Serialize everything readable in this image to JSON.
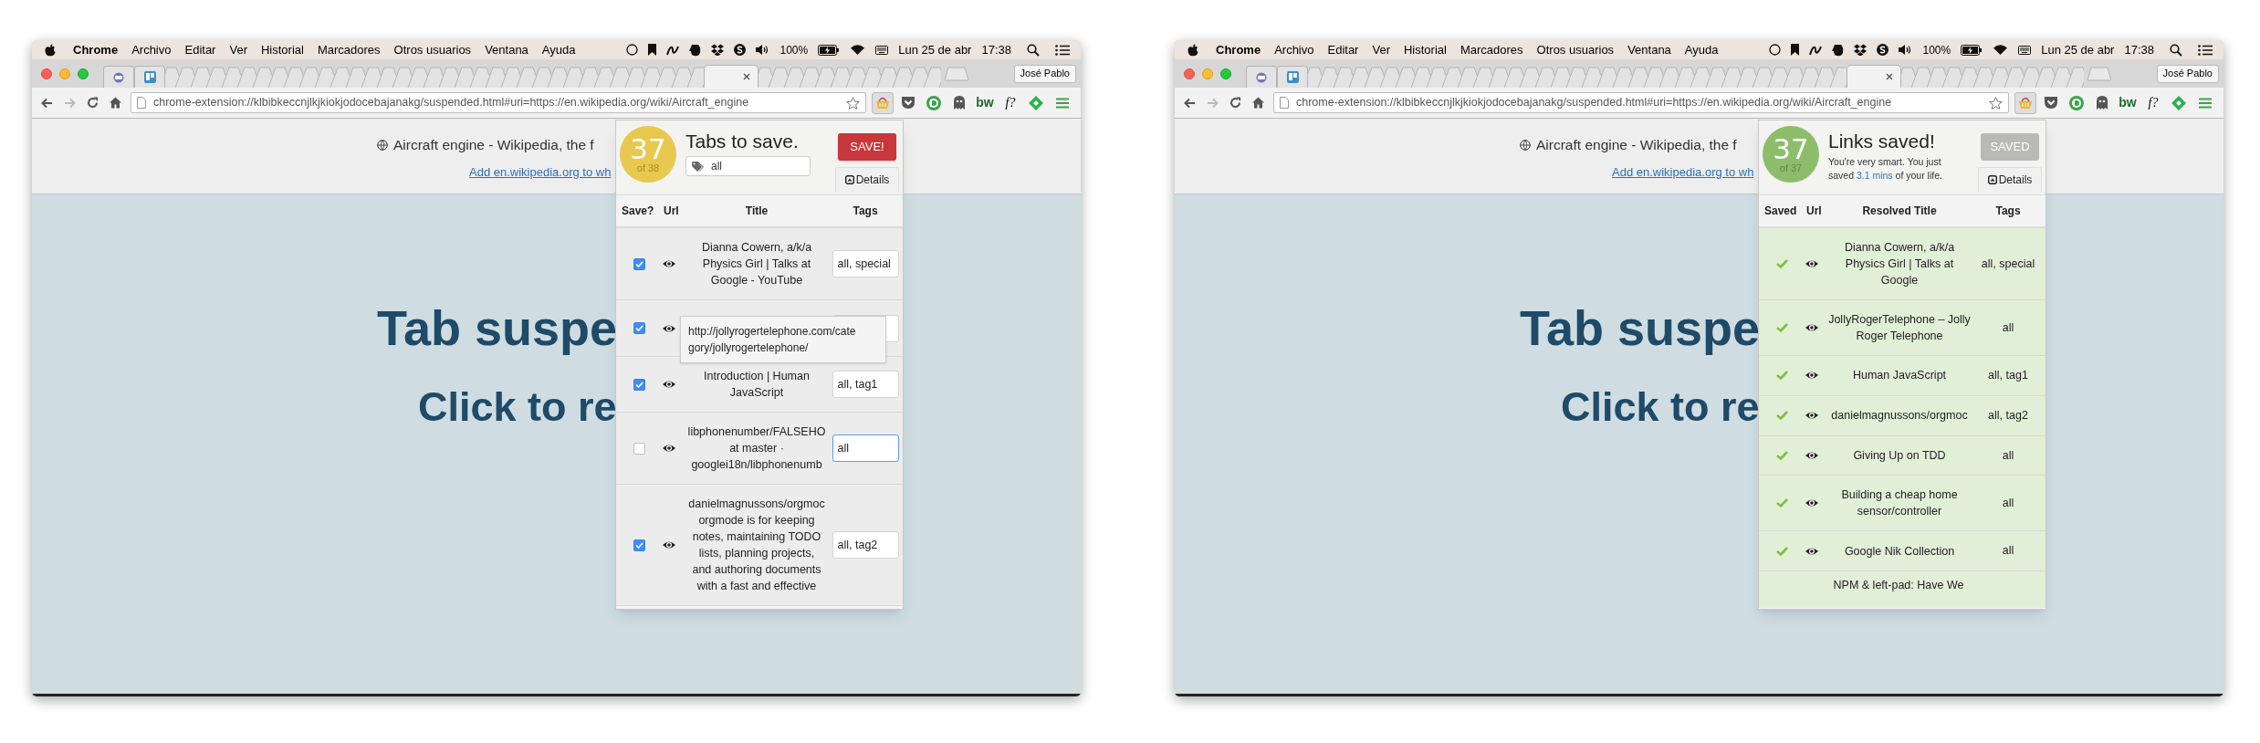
{
  "windows": [
    {
      "menu_bar": {
        "app": "Chrome",
        "items": [
          "Archivo",
          "Editar",
          "Ver",
          "Historial",
          "Marcadores",
          "Otros usuarios",
          "Ventana",
          "Ayuda"
        ],
        "battery": "100%",
        "date": "Lun 25 de abr",
        "time": "17:38"
      },
      "profile": "José Pablo",
      "url": "chrome-extension://klbibkeccnjlkjkiokjodocebajanakg/suspended.html#uri=https://en.wikipedia.org/wiki/Aircraft_engine",
      "extensions": [
        {
          "kind": "basket",
          "active": true
        },
        {
          "kind": "pocket",
          "active": false
        },
        {
          "kind": "ring",
          "active": false
        },
        {
          "kind": "ghost",
          "active": false
        },
        {
          "kind": "text",
          "label": "bw",
          "active": false
        },
        {
          "kind": "text",
          "label": "f?",
          "active": false
        },
        {
          "kind": "diamond",
          "active": false
        }
      ],
      "page": {
        "title": "Aircraft engine - Wikipedia, the f",
        "link": "Add en.wikipedia.org to wh",
        "heading": "Tab suspe",
        "subheading": "Click to re"
      },
      "popup": {
        "kind": "pending",
        "count": "37",
        "total": "of 38",
        "title": "Tabs to save.",
        "tag_filter": "all",
        "button": {
          "label": "SAVE!",
          "disabled": false
        },
        "details": "Details",
        "columns": [
          "Save?",
          "Url",
          "Title",
          "Tags"
        ],
        "rows": [
          {
            "checked": true,
            "focused": false,
            "title_lines": [
              "Dianna Cowern, a/k/a",
              "Physics Girl | Talks at",
              "Google - YouTube"
            ],
            "tags": "all, special"
          },
          {
            "checked": true,
            "focused": false
          },
          {
            "checked": true,
            "focused": false,
            "title_lines": [
              "Introduction | Human",
              "JavaScript"
            ],
            "tags": "all, tag1"
          },
          {
            "checked": false,
            "focused": true,
            "title_lines": [
              "libphonenumber/FALSEHO",
              "at master ·",
              "googlei18n/libphonenumb"
            ],
            "tags": "all"
          },
          {
            "checked": true,
            "focused": false,
            "title_lines": [
              "danielmagnussons/orgmoc",
              "orgmode is for keeping",
              "notes, maintaining TODO",
              "lists, planning projects,",
              "and authoring documents",
              "with a fast and effective"
            ],
            "tags": "all, tag2"
          }
        ],
        "tooltip_lines": [
          "http://jollyrogertelephone.com/cate",
          "gory/jollyrogertelephone/"
        ]
      }
    },
    {
      "menu_bar": {
        "app": "Chrome",
        "items": [
          "Archivo",
          "Editar",
          "Ver",
          "Historial",
          "Marcadores",
          "Otros usuarios",
          "Ventana",
          "Ayuda"
        ],
        "battery": "100%",
        "date": "Lun 25 de abr",
        "time": "17:38"
      },
      "profile": "José Pablo",
      "url": "chrome-extension://klbibkeccnjlkjkiokjodocebajanakg/suspended.html#uri=https://en.wikipedia.org/wiki/Aircraft_engine",
      "extensions": [
        {
          "kind": "basket",
          "active": true
        },
        {
          "kind": "pocket",
          "active": false
        },
        {
          "kind": "ring",
          "active": false
        },
        {
          "kind": "ghost",
          "active": false
        },
        {
          "kind": "text",
          "label": "bw",
          "active": false
        },
        {
          "kind": "text",
          "label": "f?",
          "active": false
        },
        {
          "kind": "diamond",
          "active": false
        }
      ],
      "page": {
        "title": "Aircraft engine - Wikipedia, the f",
        "link": "Add en.wikipedia.org to wh",
        "heading": "Tab suspe",
        "subheading": "Click to re"
      },
      "popup": {
        "kind": "saved",
        "count": "37",
        "total": "of 37",
        "title": "Links saved!",
        "message_start": "You're very smart. You just saved ",
        "message_link": "3.1 mins",
        "message_end": " of your life.",
        "button": {
          "label": "SAVED",
          "disabled": true
        },
        "details": "Details",
        "columns": [
          "Saved",
          "Url",
          "Resolved Title",
          "Tags"
        ],
        "rows": [
          {
            "saved": true,
            "title_lines": [
              "Dianna Cowern, a/k/a",
              "Physics Girl | Talks at",
              "Google"
            ],
            "tags": "all, special"
          },
          {
            "saved": true,
            "title_lines": [
              "JollyRogerTelephone – Jolly",
              "Roger Telephone"
            ],
            "tags": "all"
          },
          {
            "saved": true,
            "title_lines": [
              "Human JavaScript"
            ],
            "tags": "all, tag1"
          },
          {
            "saved": true,
            "title_lines": [
              "danielmagnussons/orgmoc"
            ],
            "tags": "all, tag2"
          },
          {
            "saved": true,
            "title_lines": [
              "Giving Up on TDD"
            ],
            "tags": "all"
          },
          {
            "saved": true,
            "title_lines": [
              "Building a cheap home",
              "sensor/controller"
            ],
            "tags": "all"
          },
          {
            "saved": true,
            "title_lines": [
              "Google Nik Collection"
            ],
            "tags": "all"
          }
        ],
        "partial_row": {
          "title": "NPM & left-pad: Have We"
        }
      }
    }
  ]
}
